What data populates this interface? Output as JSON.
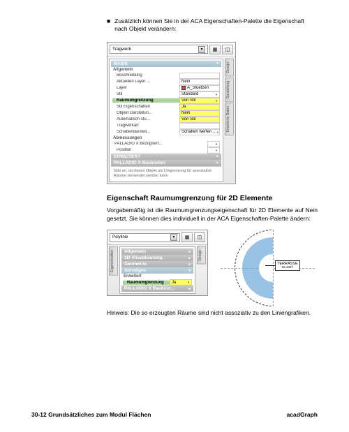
{
  "bullet": {
    "mark": "■",
    "text": "Zusätzlich können Sie in der ACA Eigenschaften-Palette die Eigenschaft nach Objekt verändern:"
  },
  "panel1": {
    "dropdown": "Tragwerk",
    "tabs": [
      "Design",
      "Darstellung",
      "Erweiterte Daten"
    ],
    "groups": {
      "basis": "BASIS",
      "allgemein": "Allgemein",
      "abmessungen": "Abmessungen",
      "erweitert": "ERWEITERT",
      "palladio": "PALLADIO X Baukosten"
    },
    "rows": [
      {
        "label": "Beschreibung",
        "value": ""
      },
      {
        "label": "Aktuellen Layer ...",
        "value": "Nein"
      },
      {
        "label": "Layer",
        "value": "A_Stuetzen",
        "icon": true
      },
      {
        "label": "Stil",
        "value": "Standard",
        "dd": true
      },
      {
        "label": "Raumumgrenzung",
        "value": "Von Stil",
        "hl": true,
        "hlLabel": true,
        "dd": true
      },
      {
        "label": "Stil Eigenschaften",
        "value": "Ja",
        "hl": true
      },
      {
        "label": "Objekt Darstellun...",
        "value": "Nein",
        "hl": true
      },
      {
        "label": "Automatisch stu...",
        "value": "Von Stil",
        "hl": true
      },
      {
        "label": "Tragwerkart",
        "value": ""
      },
      {
        "label": "Schattendarstell...",
        "value": "Schatten werfen ...",
        "dd": true
      }
    ],
    "rows2": [
      {
        "label": "PALLADIO X Bezugsert...",
        "value": "",
        "dd": true
      },
      {
        "label": "Position",
        "value": "",
        "dd": true
      }
    ],
    "help": "Gibt an, ob dieses Objekt als Umgrenzung für assoziative Räume verwendet werden kann"
  },
  "heading": "Eigenschaft Raumumgrenzung für 2D Elemente",
  "para": "Vorgabemäßig ist die Raumumgrenzungseigenschaft für 2D Elemente auf Nein gesetzt. Sie können dies individuell in der ACA Eigenschaften-Palette ändern:",
  "panel2": {
    "dropdown": "Polylinie",
    "tabs_left": [
      "Eigenschaften"
    ],
    "tabs_right": [
      "Design"
    ],
    "groups": {
      "allgemein": "Allgemein",
      "vis3d": "3D-Visualisierung",
      "geom": "Geometrie",
      "sonst": "Sonstiges",
      "erw": "Erweitert",
      "palladio": "PALLADIO X Baukost..."
    },
    "rows": [
      {
        "label": "Raumumgrenzung",
        "value": "Ja",
        "hl": true,
        "hlLabel": true,
        "dd": true
      }
    ]
  },
  "terrace": {
    "label": "TERRASSE",
    "sub": "18.13m²"
  },
  "note": "Hinweis: Die so erzeugten Räume sind nicht assoziativ zu den Liniengrafiken.",
  "footer": {
    "left": "30-12 Grundsätzliches zum Modul Flächen",
    "right": "acadGraph"
  }
}
